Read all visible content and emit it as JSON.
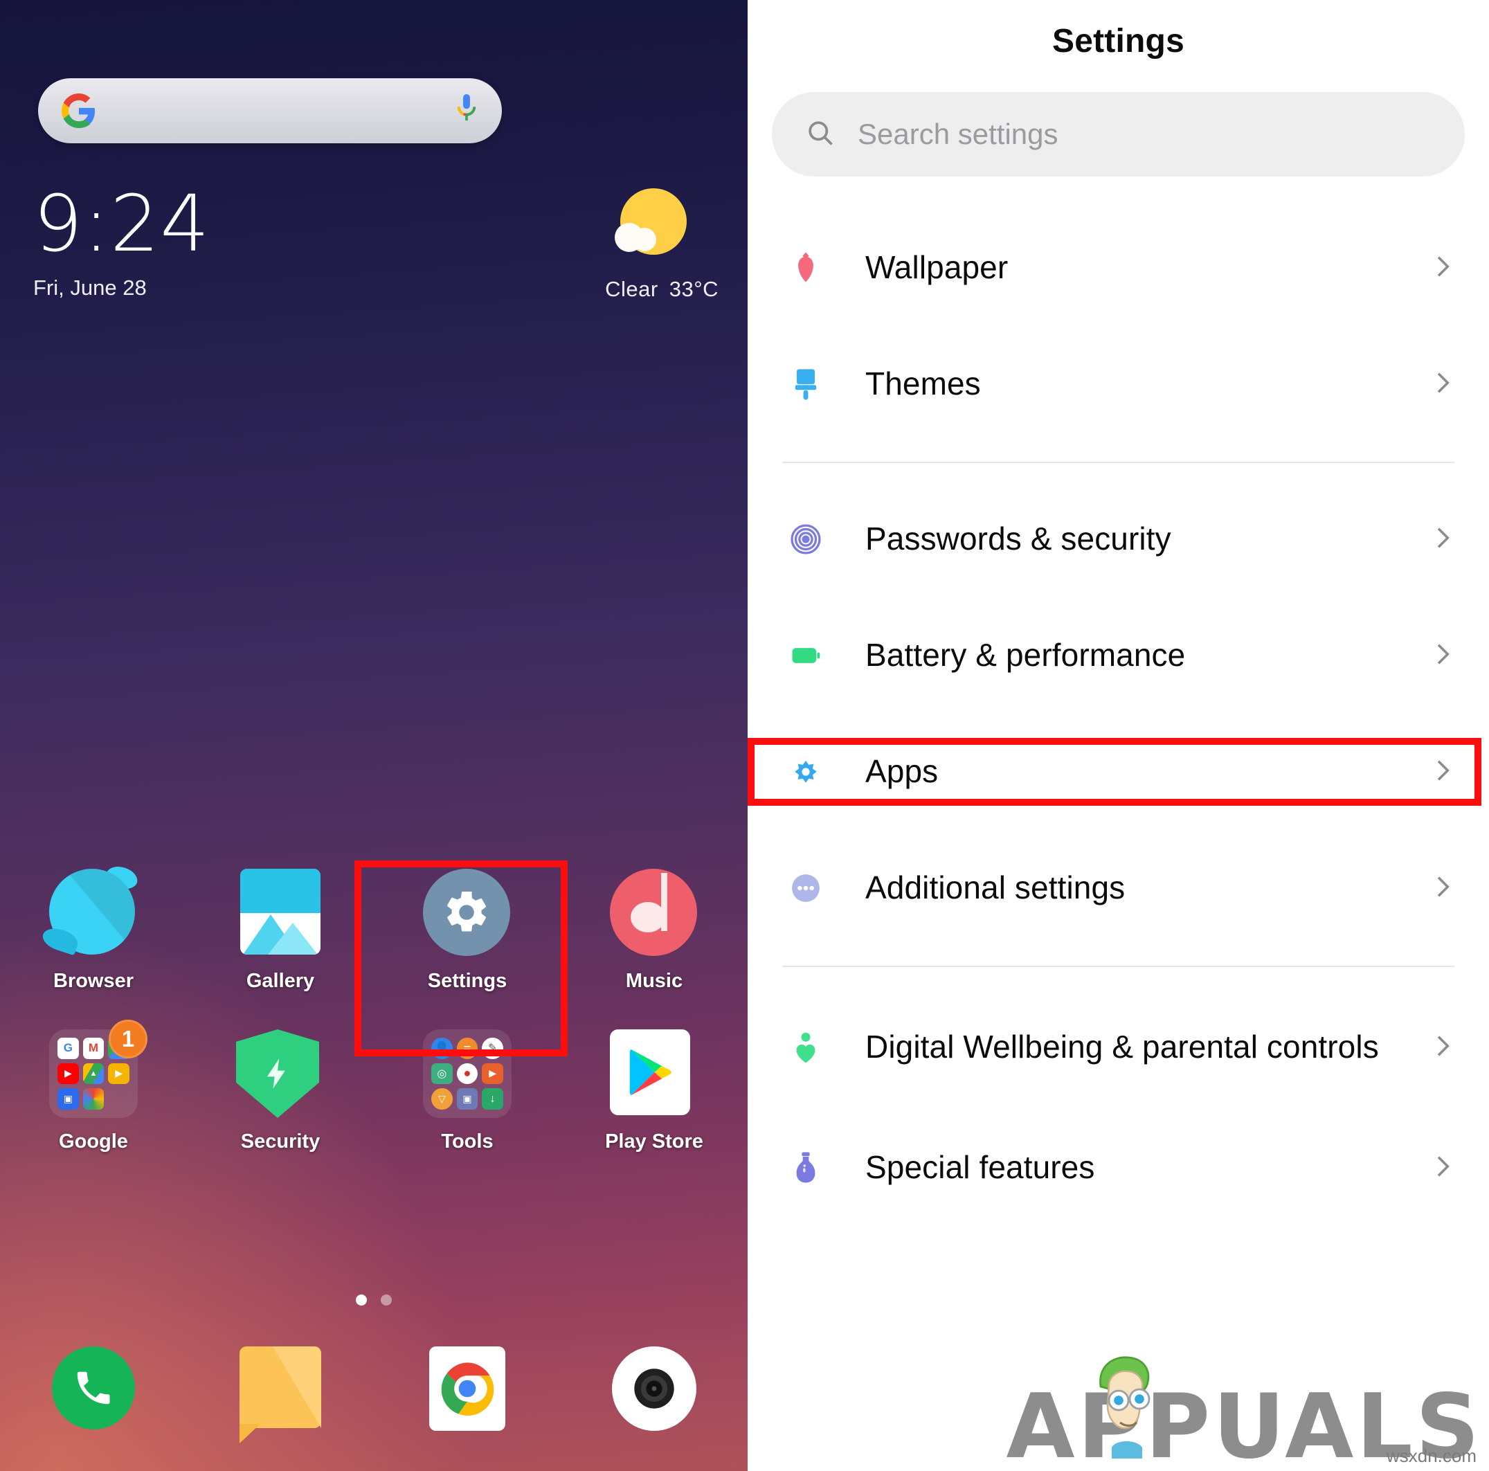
{
  "accent": {
    "highlight_box": "#fd0d0d"
  },
  "home": {
    "search_widget": {
      "name": "Google search bar",
      "logo": "google-g-icon",
      "mic": "microphone-icon"
    },
    "clock": {
      "time": "9:24",
      "date": "Fri, June 28"
    },
    "weather": {
      "condition": "Clear",
      "temperature": "33°C",
      "icon": "sun-behind-cloud-icon"
    },
    "apps": [
      {
        "label": "Browser",
        "icon": "browser-planet-icon",
        "highlighted": false
      },
      {
        "label": "Gallery",
        "icon": "gallery-photo-icon",
        "highlighted": false
      },
      {
        "label": "Settings",
        "icon": "settings-gear-icon",
        "highlighted": true
      },
      {
        "label": "Music",
        "icon": "music-note-icon",
        "highlighted": false
      },
      {
        "label": "Google",
        "icon": "google-folder-icon",
        "badge": "1",
        "highlighted": false
      },
      {
        "label": "Security",
        "icon": "security-shield-icon",
        "highlighted": false
      },
      {
        "label": "Tools",
        "icon": "tools-folder-icon",
        "highlighted": false
      },
      {
        "label": "Play Store",
        "icon": "play-store-icon",
        "highlighted": false
      }
    ],
    "page_indicator": {
      "pages": 2,
      "current": 1
    },
    "dock": [
      {
        "label": "Phone",
        "icon": "phone-handset-icon"
      },
      {
        "label": "Messages",
        "icon": "message-bubble-icon"
      },
      {
        "label": "Chrome",
        "icon": "chrome-icon"
      },
      {
        "label": "Camera",
        "icon": "camera-lens-icon"
      }
    ]
  },
  "settings": {
    "title": "Settings",
    "search": {
      "placeholder": "Search settings",
      "icon": "search-icon"
    },
    "groups": [
      {
        "items": [
          {
            "label": "Wallpaper",
            "icon": "tulip-icon",
            "icon_color": "#f5697f",
            "chevron": "chevron-right-icon",
            "highlighted": false
          },
          {
            "label": "Themes",
            "icon": "paintbrush-icon",
            "icon_color": "#38aff0",
            "chevron": "chevron-right-icon",
            "highlighted": false
          }
        ]
      },
      {
        "items": [
          {
            "label": "Passwords & security",
            "icon": "fingerprint-icon",
            "icon_color": "#7b7ae0",
            "chevron": "chevron-right-icon",
            "highlighted": false
          },
          {
            "label": "Battery & performance",
            "icon": "battery-icon",
            "icon_color": "#32da84",
            "chevron": "chevron-right-icon",
            "highlighted": false
          },
          {
            "label": "Apps",
            "icon": "apps-flower-icon",
            "icon_color": "#34a8f0",
            "chevron": "chevron-right-icon",
            "highlighted": true
          },
          {
            "label": "Additional settings",
            "icon": "ellipsis-icon",
            "icon_color": "#aeb7e8",
            "chevron": "chevron-right-icon",
            "highlighted": false
          }
        ]
      },
      {
        "items": [
          {
            "label": "Digital Wellbeing & parental controls",
            "icon": "heart-person-icon",
            "icon_color": "#3fe08b",
            "chevron": "chevron-right-icon",
            "highlighted": false
          },
          {
            "label": "Special features",
            "icon": "potion-flask-icon",
            "icon_color": "#7b7ae0",
            "chevron": "chevron-right-icon",
            "highlighted": false
          }
        ]
      }
    ]
  },
  "watermark": {
    "brand": "APPUALS",
    "url": "wsxdn.com",
    "mascot": "appuals-mascot-icon"
  }
}
